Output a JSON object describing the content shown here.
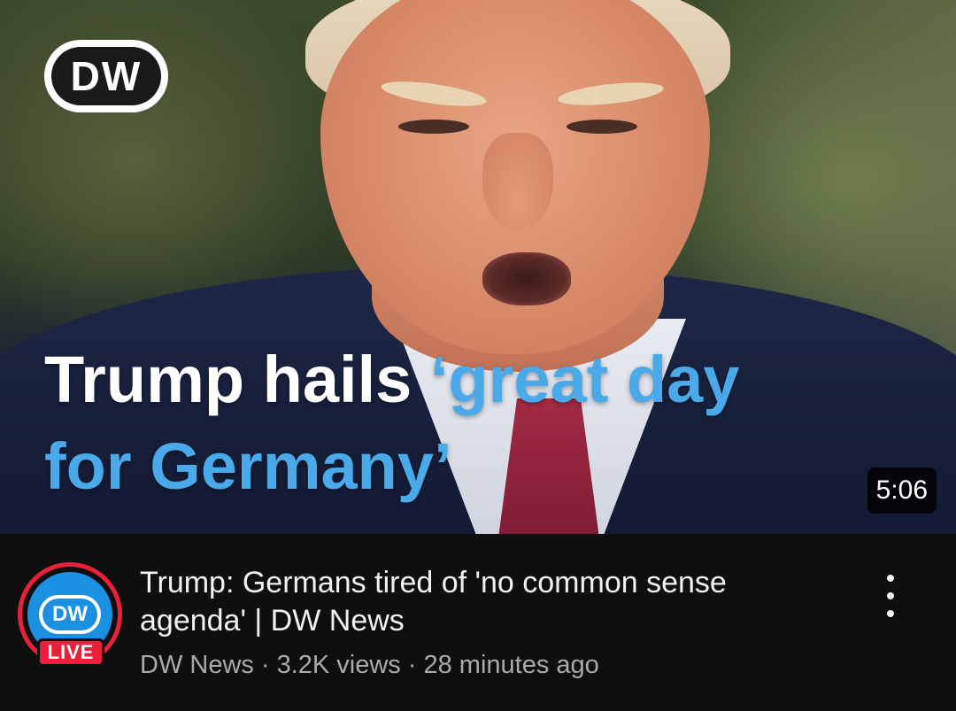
{
  "video": {
    "thumbnail_headline_white": "Trump hails ",
    "thumbnail_headline_blue": "‘great day for Germany’",
    "thumbnail_logo_text": "DW",
    "duration": "5:06",
    "title": "Trump: Germans tired of 'no common sense agenda' | DW News",
    "channel": "DW News",
    "views": "3.2K views",
    "age": "28 minutes ago",
    "separator": "·"
  },
  "channel_avatar": {
    "logo_text": "DW",
    "live_label": "LIVE"
  },
  "icons": {
    "more": "more-vert-icon"
  },
  "colors": {
    "background": "#0f0f0f",
    "live_red": "#e8203a",
    "headline_blue": "#4aa9e8",
    "avatar_blue": "#1b8fe0",
    "meta_text": "#aaaaaa"
  }
}
